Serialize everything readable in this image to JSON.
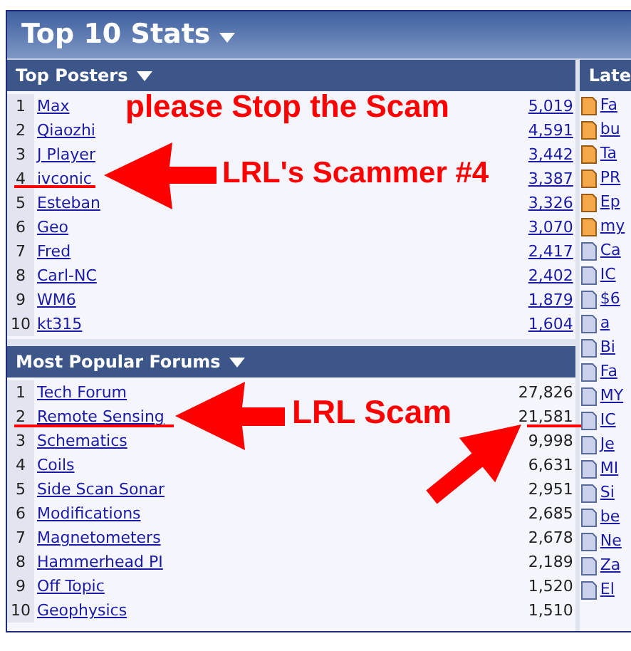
{
  "title": "Top 10 Stats",
  "top_posters": {
    "title": "Top Posters",
    "rows": [
      {
        "rank": "1",
        "name": "Max",
        "count": "5,019"
      },
      {
        "rank": "2",
        "name": "Qiaozhi",
        "count": "4,591"
      },
      {
        "rank": "3",
        "name": "J Player",
        "count": "3,442"
      },
      {
        "rank": "4",
        "name": "ivconic",
        "count": "3,387"
      },
      {
        "rank": "5",
        "name": "Esteban",
        "count": "3,326"
      },
      {
        "rank": "6",
        "name": "Geo",
        "count": "3,070"
      },
      {
        "rank": "7",
        "name": "Fred",
        "count": "2,417"
      },
      {
        "rank": "8",
        "name": "Carl-NC",
        "count": "2,402"
      },
      {
        "rank": "9",
        "name": "WM6",
        "count": "1,879"
      },
      {
        "rank": "10",
        "name": "kt315",
        "count": "1,604"
      }
    ]
  },
  "popular_forums": {
    "title": "Most Popular Forums",
    "rows": [
      {
        "rank": "1",
        "name": "Tech Forum",
        "count": "27,826"
      },
      {
        "rank": "2",
        "name": "Remote Sensing",
        "count": "21,581"
      },
      {
        "rank": "3",
        "name": "Schematics",
        "count": "9,998"
      },
      {
        "rank": "4",
        "name": "Coils",
        "count": "6,631"
      },
      {
        "rank": "5",
        "name": "Side Scan Sonar",
        "count": "2,951"
      },
      {
        "rank": "6",
        "name": "Modifications",
        "count": "2,685"
      },
      {
        "rank": "7",
        "name": "Magnetometers",
        "count": "2,678"
      },
      {
        "rank": "8",
        "name": "Hammerhead PI",
        "count": "2,189"
      },
      {
        "rank": "9",
        "name": "Off Topic",
        "count": "1,520"
      },
      {
        "rank": "10",
        "name": "Geophysics",
        "count": "1,510"
      }
    ]
  },
  "latest": {
    "title": "Late",
    "items": [
      {
        "text": "Fa",
        "hot": true
      },
      {
        "text": "bu",
        "hot": true
      },
      {
        "text": "Ta",
        "hot": true
      },
      {
        "text": "PR",
        "hot": true
      },
      {
        "text": "Ep",
        "hot": true
      },
      {
        "text": "my",
        "hot": true
      },
      {
        "text": "Ca",
        "hot": false
      },
      {
        "text": "IC",
        "hot": false
      },
      {
        "text": "$6",
        "hot": false
      },
      {
        "text": "a",
        "hot": false
      },
      {
        "text": "Bi",
        "hot": false
      },
      {
        "text": "Fa",
        "hot": false
      },
      {
        "text": "MY",
        "hot": false
      },
      {
        "text": "IC",
        "hot": false
      },
      {
        "text": "Je",
        "hot": false
      },
      {
        "text": "MI",
        "hot": false
      },
      {
        "text": "Si",
        "hot": false
      },
      {
        "text": "be",
        "hot": false
      },
      {
        "text": "Ne",
        "hot": false
      },
      {
        "text": "Za",
        "hot": false
      },
      {
        "text": "El",
        "hot": false
      }
    ]
  },
  "annotations": [
    "please Stop the Scam",
    "LRL's Scammer #4",
    "LRL Scam"
  ]
}
